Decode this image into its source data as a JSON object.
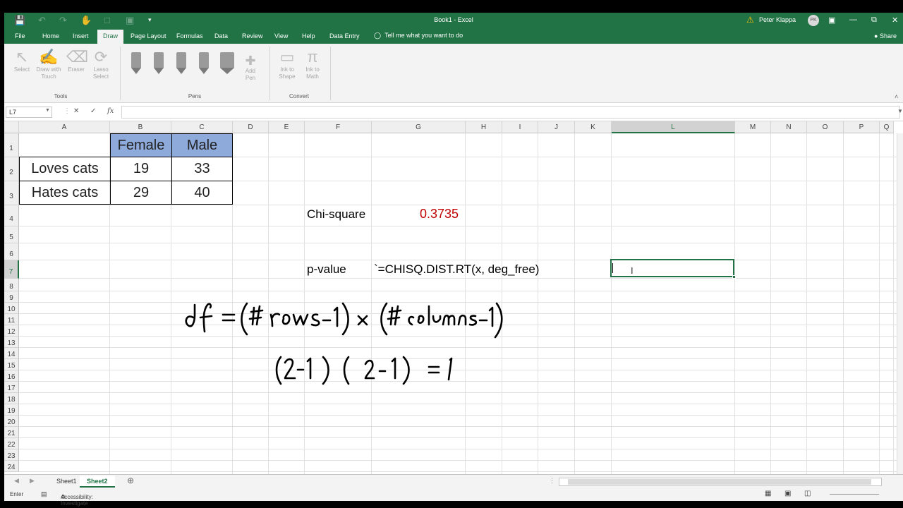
{
  "window": {
    "title": "Book1  -  Excel",
    "user": "Peter Klappa",
    "user_initials": "PK"
  },
  "tabs": [
    "File",
    "Home",
    "Insert",
    "Draw",
    "Page Layout",
    "Formulas",
    "Data",
    "Review",
    "View",
    "Help",
    "Data Entry"
  ],
  "active_tab": "Draw",
  "tell_me": "Tell me what you want to do",
  "share": "Share",
  "ribbon": {
    "tools": {
      "label": "Tools",
      "select": "Select",
      "draw_touch": "Draw with Touch",
      "eraser": "Eraser",
      "lasso": "Lasso Select"
    },
    "pens": {
      "label": "Pens",
      "add_pen": "Add Pen"
    },
    "convert": {
      "label": "Convert",
      "ink_shape": "Ink to Shape",
      "ink_math": "Ink to Math"
    }
  },
  "formula_bar": {
    "name_box": "L7",
    "cancel": "✕",
    "enter": "✓",
    "fx": "fx",
    "value": ""
  },
  "columns": [
    "A",
    "B",
    "C",
    "D",
    "E",
    "F",
    "G",
    "H",
    "I",
    "J",
    "K",
    "L",
    "M",
    "N",
    "O",
    "P",
    "Q"
  ],
  "rows": [
    "1",
    "2",
    "3",
    "4",
    "5",
    "6",
    "7",
    "8",
    "9",
    "10",
    "11",
    "12",
    "13",
    "14",
    "15",
    "16",
    "17",
    "18",
    "19",
    "20",
    "21",
    "22",
    "23",
    "24"
  ],
  "selected_cell": {
    "col": "L",
    "row": "7"
  },
  "table": {
    "headers": [
      "Female",
      "Male"
    ],
    "rows": [
      {
        "label": "Loves cats",
        "female": "19",
        "male": "33"
      },
      {
        "label": "Hates cats",
        "female": "29",
        "male": "40"
      }
    ],
    "header_color": "#8eaadb"
  },
  "cells": {
    "chi_label": "Chi-square",
    "chi_value": "0.3735",
    "chi_value_color": "#c00000",
    "p_label": "p-value",
    "formula_text": "`=CHISQ.DIST.RT(x, deg_free)"
  },
  "handwriting": {
    "line1": "df = (# rows - 1) × (# columns - 1)",
    "line2": "(2-1) (2-1) = 1"
  },
  "sheets": [
    "Sheet1",
    "Sheet2"
  ],
  "active_sheet": "Sheet2",
  "status": {
    "mode": "Enter",
    "accessibility": "Accessibility: Investigate"
  },
  "colors": {
    "accent": "#217346"
  }
}
